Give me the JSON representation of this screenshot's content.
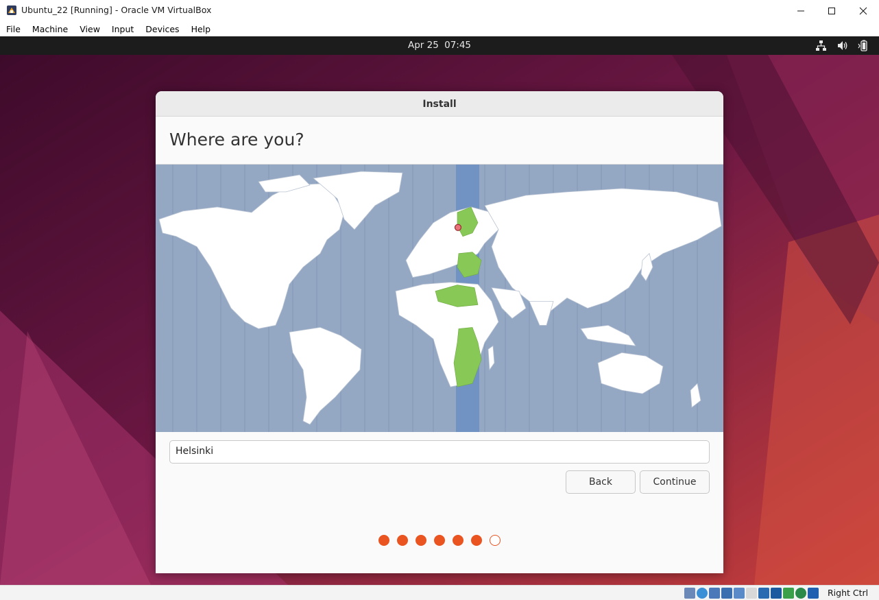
{
  "window": {
    "title": "Ubuntu_22 [Running] - Oracle VM VirtualBox",
    "menu": [
      "File",
      "Machine",
      "View",
      "Input",
      "Devices",
      "Help"
    ]
  },
  "topbar": {
    "date": "Apr 25",
    "time": "07:45"
  },
  "installer": {
    "window_title": "Install",
    "heading": "Where are you?",
    "timezone_value": "Helsinki",
    "back_label": "Back",
    "continue_label": "Continue",
    "progress": {
      "completed_steps": 6,
      "total_steps": 7
    }
  },
  "statusbar": {
    "host_key": "Right Ctrl"
  },
  "colors": {
    "accent": "#e95420",
    "ocean": "#94a8c4",
    "selected_zone_band": "#7193c4",
    "selected_zone_land": "#88c856",
    "land": "#ffffff"
  }
}
